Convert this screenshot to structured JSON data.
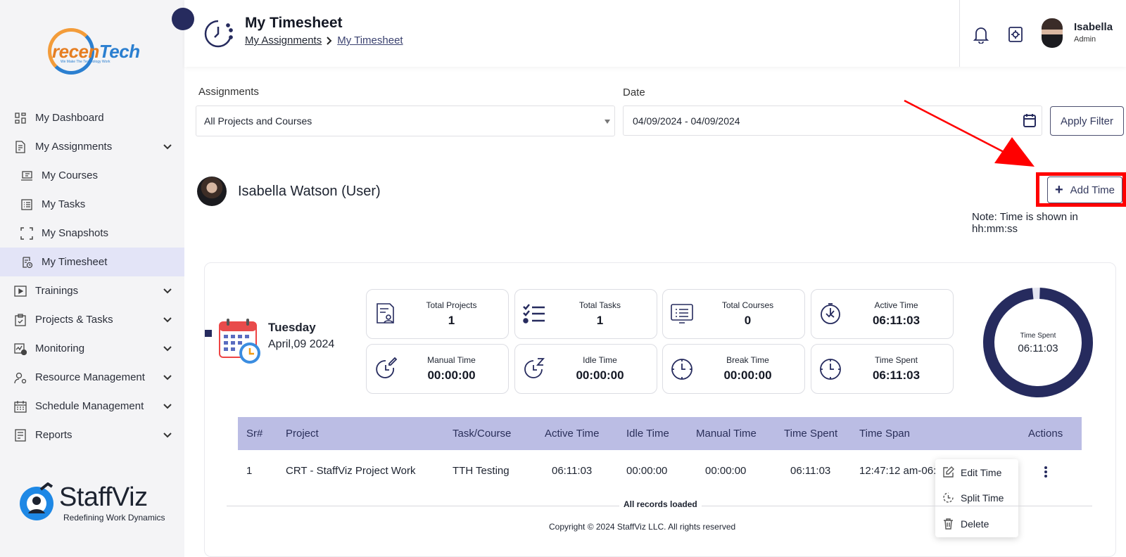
{
  "sidebar": {
    "logo_top": {
      "brand_left": "recen",
      "brand_right": "Tech",
      "tagline": "We Make The Technology Work"
    },
    "items": [
      {
        "label": "My Dashboard",
        "icon": "dashboard-icon"
      },
      {
        "label": "My Assignments",
        "icon": "assignments-icon"
      },
      {
        "label": "My Courses",
        "icon": "courses-icon"
      },
      {
        "label": "My Tasks",
        "icon": "tasks-icon"
      },
      {
        "label": "My Snapshots",
        "icon": "snapshot-icon"
      },
      {
        "label": "My Timesheet",
        "icon": "timesheet-icon"
      },
      {
        "label": "Trainings",
        "icon": "play-icon"
      },
      {
        "label": "Projects & Tasks",
        "icon": "clipboard-icon"
      },
      {
        "label": "Monitoring",
        "icon": "monitoring-icon"
      },
      {
        "label": "Resource Management",
        "icon": "resource-icon"
      },
      {
        "label": "Schedule Management",
        "icon": "schedule-icon"
      },
      {
        "label": "Reports",
        "icon": "reports-icon"
      }
    ],
    "logo_bottom": {
      "name": "StaffViz",
      "tagline": "Redefining Work Dynamics"
    }
  },
  "header": {
    "title": "My Timesheet",
    "breadcrumb": [
      "My Assignments",
      "My Timesheet"
    ],
    "user": {
      "name": "Isabella",
      "role": "Admin"
    }
  },
  "filters": {
    "assignments_label": "Assignments",
    "assignments_value": "All Projects and Courses",
    "date_label": "Date",
    "date_value": "04/09/2024 - 04/09/2024",
    "apply_label": "Apply Filter"
  },
  "user_row": {
    "name": "Isabella Watson (User)",
    "add_time_label": "Add Time",
    "note": "Note: Time is shown in hh:mm:ss"
  },
  "summary": {
    "day": "Tuesday",
    "date": "April,09 2024",
    "stats": [
      {
        "label": "Total Projects",
        "value": "1",
        "icon": "projects-icon"
      },
      {
        "label": "Total Tasks",
        "value": "1",
        "icon": "checklist-icon"
      },
      {
        "label": "Total Courses",
        "value": "0",
        "icon": "monitor-list-icon"
      },
      {
        "label": "Active Time",
        "value": "06:11:03",
        "icon": "active-clock-icon"
      },
      {
        "label": "Manual Time",
        "value": "00:00:00",
        "icon": "manual-clock-icon"
      },
      {
        "label": "Idle Time",
        "value": "00:00:00",
        "icon": "idle-clock-icon"
      },
      {
        "label": "Break Time",
        "value": "00:00:00",
        "icon": "break-clock-icon"
      },
      {
        "label": "Time Spent",
        "value": "06:11:03",
        "icon": "spent-clock-icon"
      }
    ],
    "donut": {
      "label": "Time Spent",
      "value": "06:11:03",
      "fraction": 1.0,
      "color": "#262b5e"
    }
  },
  "table": {
    "columns": [
      "Sr#",
      "Project",
      "Task/Course",
      "Active Time",
      "Idle Time",
      "Manual Time",
      "Time Spent",
      "Time Span",
      "Actions"
    ],
    "rows": [
      {
        "sr": "1",
        "project": "CRT - StaffViz Project Work",
        "task": "TTH Testing",
        "active": "06:11:03",
        "idle": "00:00:00",
        "manual": "00:00:00",
        "spent": "06:11:03",
        "span": "12:47:12 am-06:"
      }
    ],
    "footer": "All records loaded"
  },
  "context_menu": [
    {
      "label": "Edit Time",
      "icon": "edit-icon"
    },
    {
      "label": "Split Time",
      "icon": "split-clock-icon"
    },
    {
      "label": "Delete",
      "icon": "trash-icon"
    }
  ],
  "copyright": "Copyright © 2024 StaffViz LLC. All rights reserved",
  "colors": {
    "accent": "#262b5e",
    "table_header": "#bbbde4",
    "highlight": "#ff0000",
    "active_nav": "#e3e4f7"
  }
}
